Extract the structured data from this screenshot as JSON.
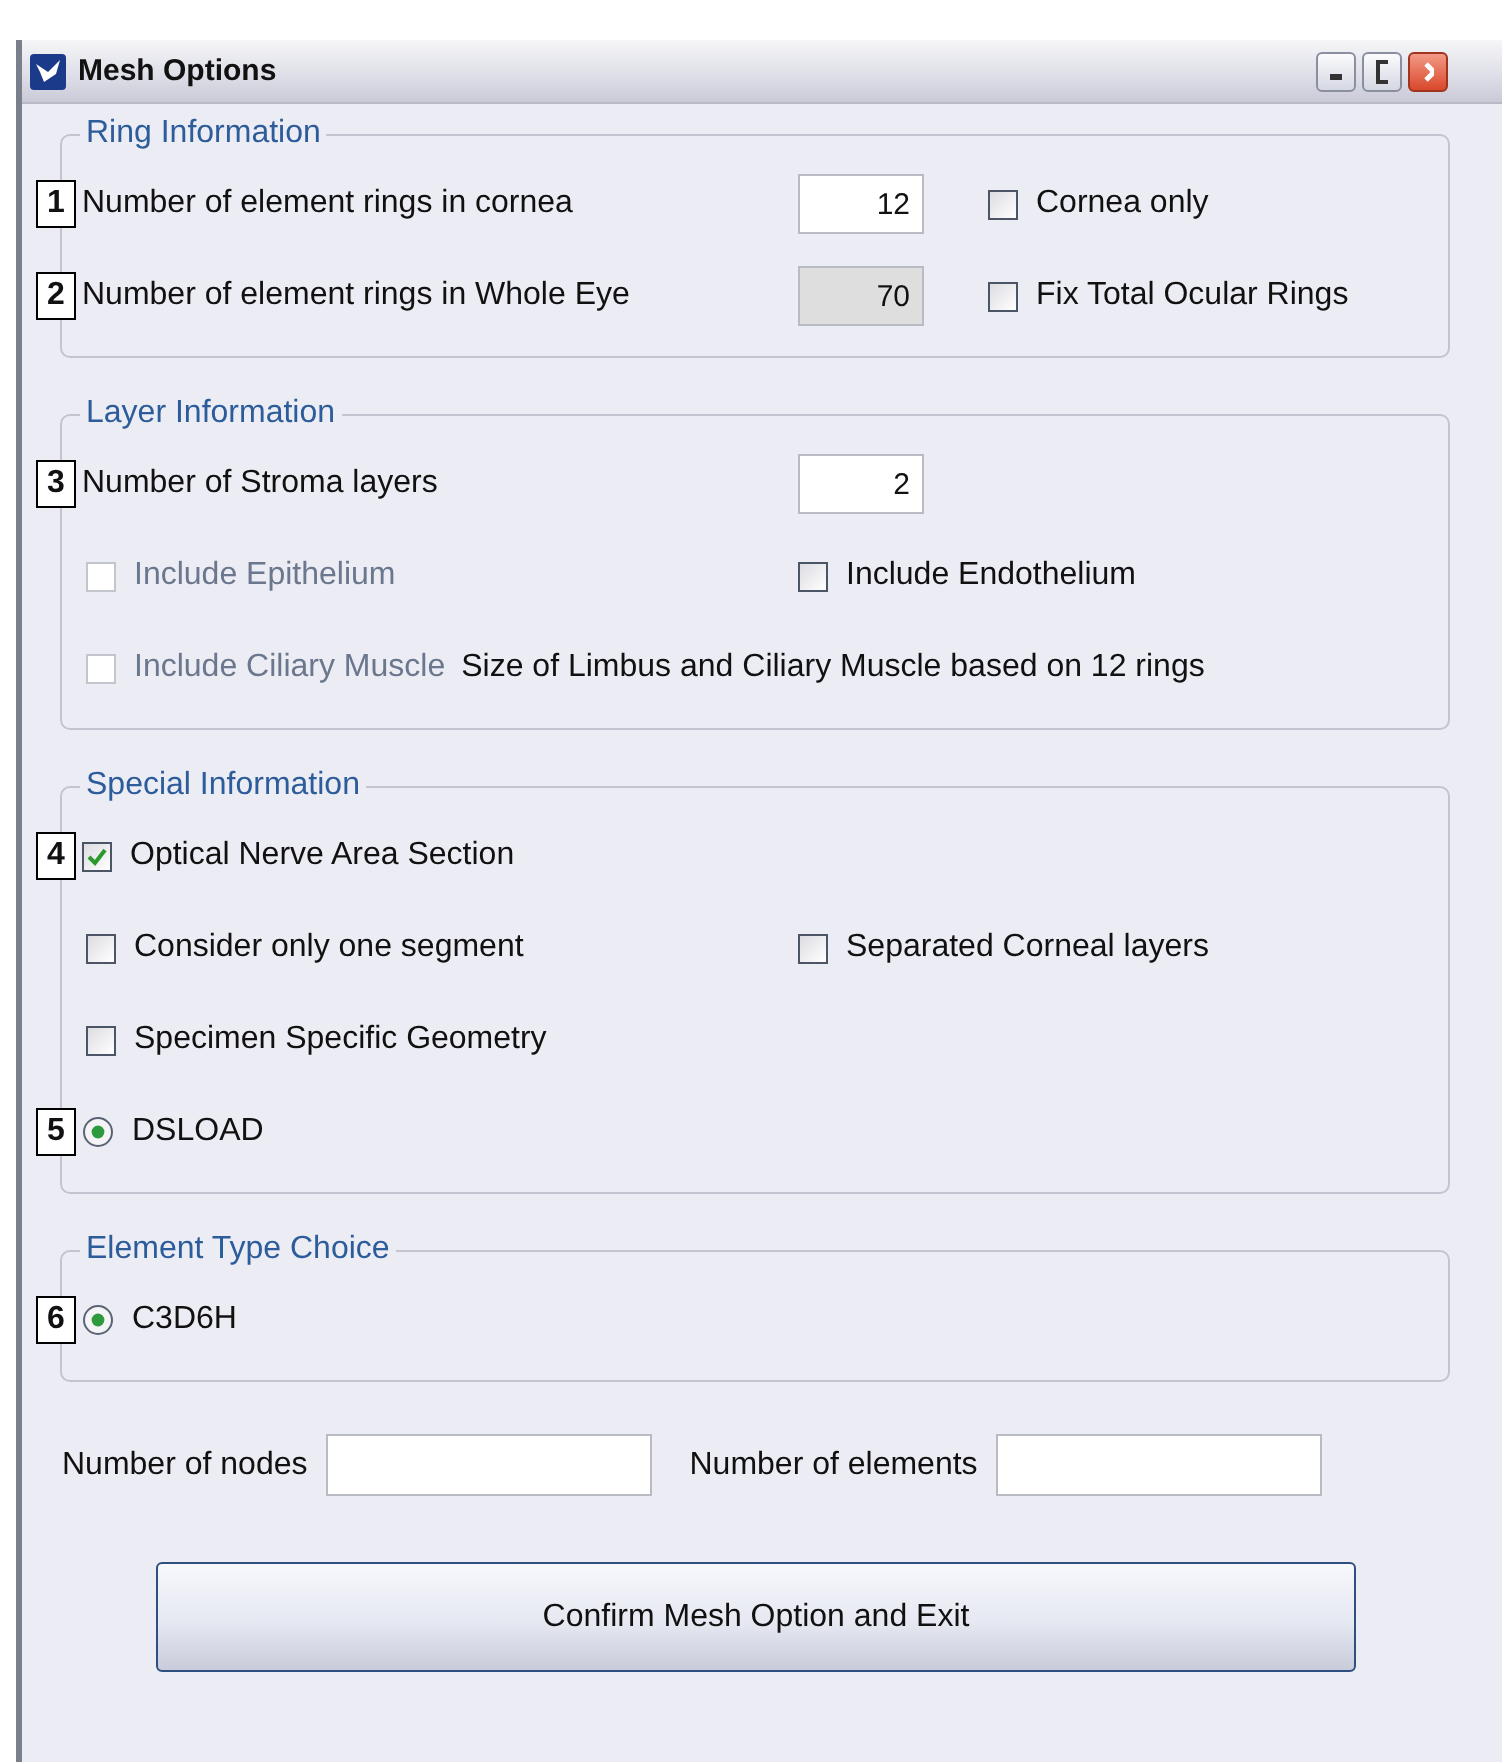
{
  "window": {
    "title": "Mesh Options"
  },
  "groups": [
    {
      "title": "Ring Information",
      "rows": [
        {
          "marker": "1",
          "a": [
            {
              "kind": "label",
              "text": "Number of element rings in cornea"
            }
          ],
          "b": [
            {
              "kind": "field",
              "value": "12",
              "disabled": false
            },
            {
              "kind": "checkbox",
              "label": "Cornea only",
              "checked": false,
              "disabled": false
            }
          ]
        },
        {
          "marker": "2",
          "a": [
            {
              "kind": "label",
              "text": "Number of element rings in Whole Eye"
            }
          ],
          "b": [
            {
              "kind": "field",
              "value": "70",
              "disabled": true
            },
            {
              "kind": "checkbox",
              "label": "Fix Total Ocular Rings",
              "checked": false,
              "disabled": false
            }
          ]
        }
      ]
    },
    {
      "title": "Layer Information",
      "rows": [
        {
          "marker": "3",
          "a": [
            {
              "kind": "label",
              "text": "Number of Stroma layers"
            }
          ],
          "b": [
            {
              "kind": "field",
              "value": "2",
              "disabled": false
            }
          ]
        },
        {
          "a": [
            {
              "kind": "checkbox",
              "label": "Include Epithelium",
              "checked": false,
              "disabled": true
            }
          ],
          "b": [
            {
              "kind": "checkbox",
              "label": "Include Endothelium",
              "checked": false,
              "disabled": false
            }
          ]
        },
        {
          "a": [
            {
              "kind": "checkbox",
              "label": "Include Ciliary Muscle",
              "checked": false,
              "disabled": true
            },
            {
              "kind": "note",
              "text": "Size of Limbus and Ciliary Muscle based on 12 rings"
            }
          ],
          "b": []
        }
      ]
    },
    {
      "title": "Special Information",
      "rows": [
        {
          "marker": "4",
          "a": [
            {
              "kind": "checkbox",
              "label": "Optical Nerve Area Section",
              "checked": true,
              "disabled": false
            }
          ],
          "b": []
        },
        {
          "a": [
            {
              "kind": "checkbox",
              "label": "Consider only one segment",
              "checked": false,
              "disabled": false
            }
          ],
          "b": [
            {
              "kind": "checkbox",
              "label": "Separated Corneal layers",
              "checked": false,
              "disabled": false
            }
          ]
        },
        {
          "a": [
            {
              "kind": "checkbox",
              "label": "Specimen Specific Geometry",
              "checked": false,
              "disabled": false
            }
          ],
          "b": []
        },
        {
          "marker": "5",
          "a": [
            {
              "kind": "radio",
              "label": "DSLOAD",
              "selected": true
            }
          ],
          "b": []
        }
      ]
    },
    {
      "title": "Element Type Choice",
      "rows": [
        {
          "marker": "6",
          "a": [
            {
              "kind": "radio",
              "label": "C3D6H",
              "selected": true
            }
          ],
          "b": []
        }
      ]
    }
  ],
  "totals": [
    {
      "label": "Number of nodes"
    },
    {
      "label": "Number of elements"
    }
  ],
  "confirm_button": "Confirm Mesh Option and Exit"
}
